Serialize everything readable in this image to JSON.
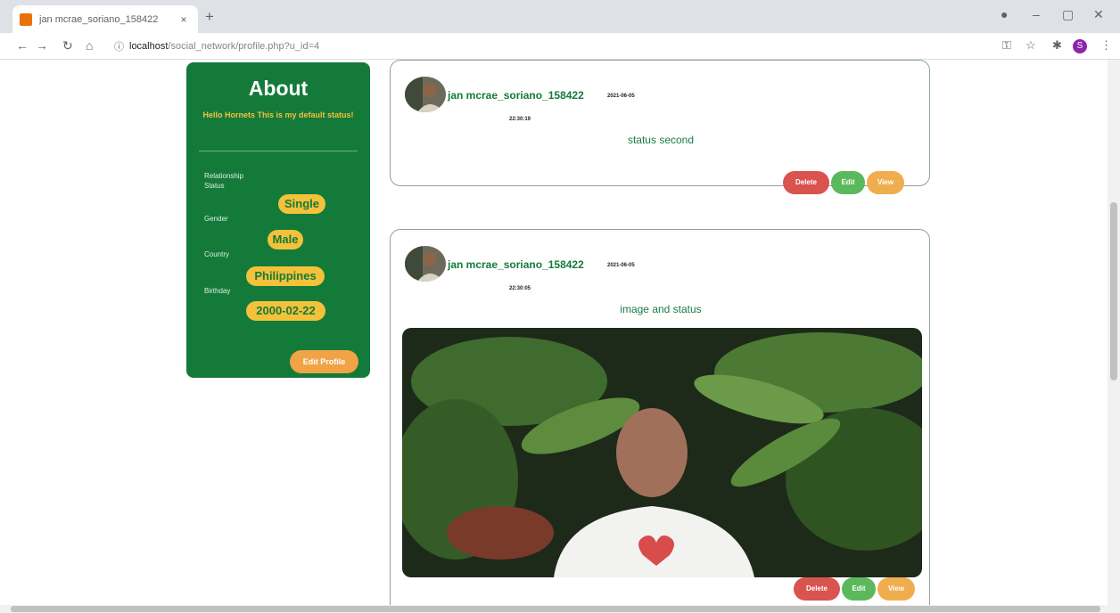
{
  "browser": {
    "tab_title": "jan mcrae_soriano_158422",
    "tab_close": "×",
    "new_tab": "+",
    "url_host": "localhost",
    "url_path": "/social_network/profile.php?u_id=4",
    "profile_initial": "S",
    "icons": [
      "record-icon",
      "minimize-icon",
      "restore-icon",
      "close-window-icon",
      "back-icon",
      "forward-icon",
      "reload-icon",
      "home-icon",
      "info-icon",
      "key-icon",
      "star-icon",
      "extensions-icon",
      "menu-icon"
    ]
  },
  "about": {
    "title": "About",
    "status": "Hello Hornets This is my default status!",
    "relationship_label": "Relationship Status",
    "relationship_value": "Single",
    "gender_label": "Gender",
    "gender_value": "Male",
    "country_label": "Country",
    "country_value": "Philippines",
    "birthday_label": "Birthday",
    "birthday_value": "2000-02-22",
    "edit_profile": "Edit Profile"
  },
  "posts": [
    {
      "author": "jan mcrae_soriano_158422",
      "date": "2021-06-05",
      "time": "22:30:19",
      "text": "status second",
      "delete": "Delete",
      "edit": "Edit",
      "view": "View"
    },
    {
      "author": "jan mcrae_soriano_158422",
      "date": "2021-06-05",
      "time": "22:30:05",
      "text": "image and status",
      "delete": "Delete",
      "edit": "Edit",
      "view": "View"
    }
  ],
  "colors": {
    "brand_green": "#147a3a",
    "accent_yellow": "#f3c13a",
    "delete_red": "#d9534f",
    "edit_green": "#5cb85c",
    "view_orange": "#f0ad4e"
  }
}
